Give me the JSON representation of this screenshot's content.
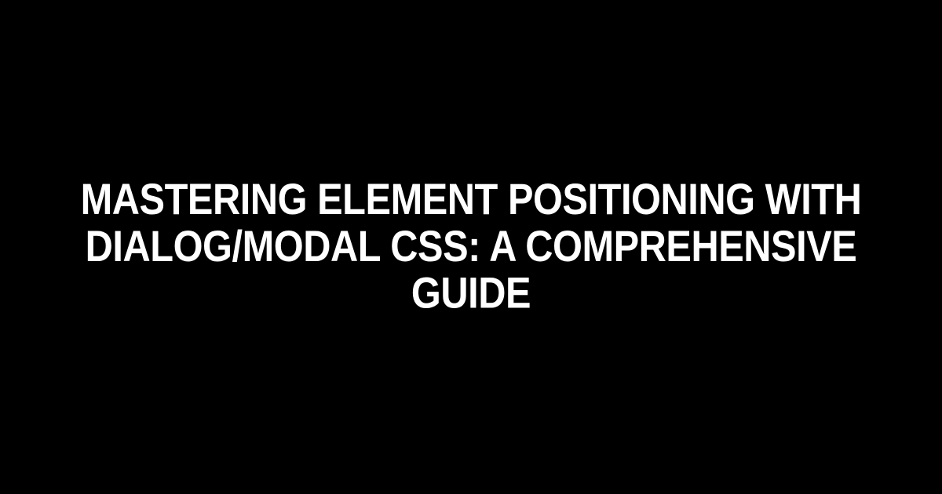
{
  "title": "Mastering Element Positioning with Dialog/Modal CSS: A Comprehensive Guide"
}
